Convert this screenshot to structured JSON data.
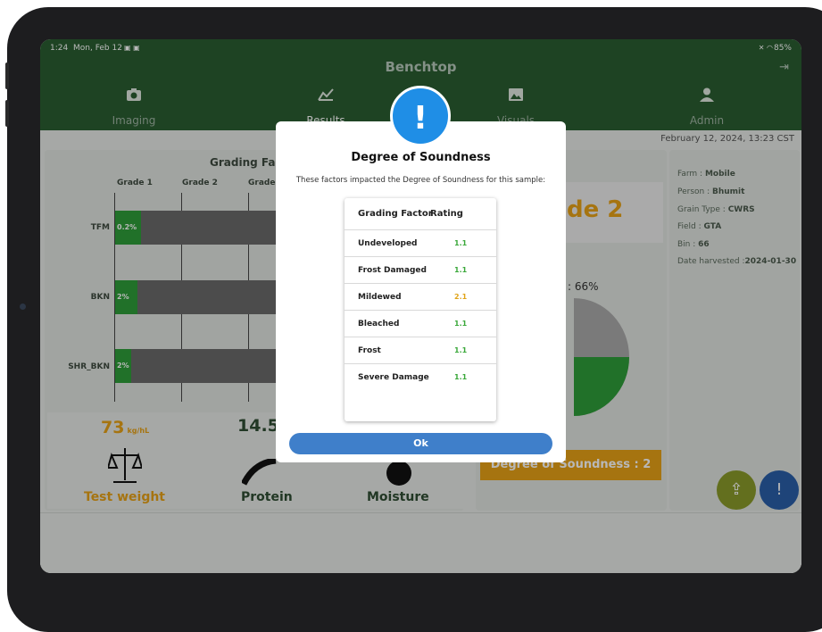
{
  "status_bar": {
    "time": "1:24",
    "date": "Mon, Feb 12",
    "battery": "85%"
  },
  "app": {
    "title": "Benchtop"
  },
  "nav": [
    {
      "label": "Imaging",
      "icon": "camera-icon"
    },
    {
      "label": "Results",
      "icon": "results-icon"
    },
    {
      "label": "Visuals",
      "icon": "image-icon"
    },
    {
      "label": "Admin",
      "icon": "person-icon"
    }
  ],
  "datetime": "February 12, 2024, 13:23  CST",
  "grading": {
    "title": "Grading Factors",
    "columns": [
      "Grade 1",
      "Grade 2",
      "Grade"
    ],
    "rows": [
      {
        "label": "TFM",
        "value": "0.2%"
      },
      {
        "label": "BKN",
        "value": "2%"
      },
      {
        "label": "SHR_BKN",
        "value": "2%"
      }
    ]
  },
  "metrics": {
    "test_weight_value": "73",
    "test_weight_unit": "kg/hL",
    "test_weight_label": "Test weight",
    "protein_value": "14.5",
    "protein_label": "Protein",
    "moisture_label": "Moisture"
  },
  "grade_card": {
    "text": "de 2",
    "pct": ": 66%",
    "soundness": "Degree of Soundness : 2"
  },
  "sample_info": [
    {
      "key": "Farm : ",
      "value": "Mobile"
    },
    {
      "key": "Person : ",
      "value": "Bhumit"
    },
    {
      "key": "Grain Type : ",
      "value": "CWRS"
    },
    {
      "key": "Field : ",
      "value": "GTA"
    },
    {
      "key": "Bin : ",
      "value": "66"
    },
    {
      "key": "Date harvested :",
      "value": "2024-01-30"
    }
  ],
  "dialog": {
    "icon": "!",
    "title": "Degree of Soundness",
    "subtitle": "These factors impacted the Degree of Soundness for this sample:",
    "header_factor": "Grading Factor",
    "header_rating": "Rating",
    "rows": [
      {
        "factor": "Undeveloped",
        "rating": "1.1",
        "color": "#3aa83a"
      },
      {
        "factor": "Frost Damaged",
        "rating": "1.1",
        "color": "#3aa83a"
      },
      {
        "factor": "Mildewed",
        "rating": "2.1",
        "color": "#e0a419"
      },
      {
        "factor": "Bleached",
        "rating": "1.1",
        "color": "#3aa83a"
      },
      {
        "factor": "Frost",
        "rating": "1.1",
        "color": "#3aa83a"
      },
      {
        "factor": "Severe Damage",
        "rating": "1.1",
        "color": "#3aa83a"
      }
    ],
    "ok_label": "Ok"
  },
  "colors": {
    "header_green": "#2a5e31",
    "bar_green": "#2f9d3a",
    "accent_orange": "#e6a117",
    "ok_blue": "#3f7fca",
    "alert_blue": "#1f8ee6"
  }
}
